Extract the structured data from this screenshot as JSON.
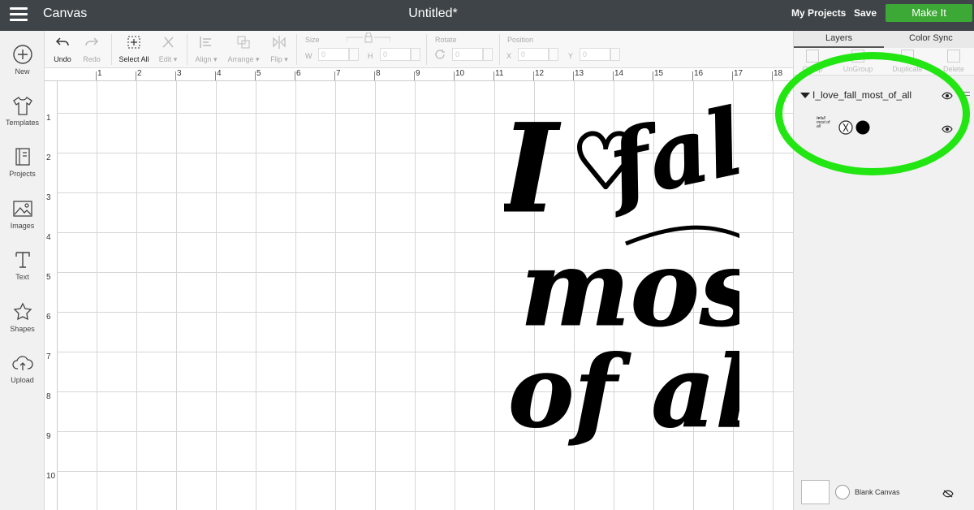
{
  "topbar": {
    "app_title": "Canvas",
    "doc_title": "Untitled*",
    "my_projects": "My Projects",
    "save": "Save",
    "make_it": "Make It",
    "make_it_color": "#3ca835"
  },
  "sidebar": {
    "items": [
      {
        "label": "New",
        "icon": "plus-circle-icon"
      },
      {
        "label": "Templates",
        "icon": "tshirt-icon"
      },
      {
        "label": "Projects",
        "icon": "book-icon"
      },
      {
        "label": "Images",
        "icon": "image-icon"
      },
      {
        "label": "Text",
        "icon": "text-t-icon"
      },
      {
        "label": "Shapes",
        "icon": "shapes-icon"
      },
      {
        "label": "Upload",
        "icon": "cloud-upload-icon"
      }
    ]
  },
  "toolbar": {
    "undo": "Undo",
    "redo": "Redo",
    "select_all": "Select All",
    "edit": "Edit ▾",
    "align": "Align ▾",
    "arrange": "Arrange ▾",
    "flip": "Flip ▾",
    "size_label": "Size",
    "w_label": "W",
    "h_label": "H",
    "w_value": "0",
    "h_value": "0",
    "rotate_label": "Rotate",
    "rotate_value": "0",
    "position_label": "Position",
    "x_label": "X",
    "y_label": "Y",
    "x_value": "0",
    "y_value": "0"
  },
  "rulers": {
    "horizontal": [
      "1",
      "2",
      "3",
      "4",
      "5",
      "6",
      "7",
      "8",
      "9",
      "10",
      "11",
      "12",
      "13",
      "14",
      "15",
      "16",
      "17",
      "18"
    ],
    "vertical": [
      "1",
      "2",
      "3",
      "4",
      "5",
      "6",
      "7",
      "8",
      "9",
      "10"
    ]
  },
  "design": {
    "lines": [
      "I",
      "fall",
      "most",
      "of all"
    ],
    "heart": "♥"
  },
  "layers_panel": {
    "tabs": [
      "Layers",
      "Color Sync"
    ],
    "actions": [
      "Group",
      "UnGroup",
      "Duplicate",
      "Delete"
    ],
    "layer_name": "I_love_fall_most_of_all",
    "thumb_text": "I♥fall most of all",
    "cut_color": "#000000",
    "blank_canvas": "Blank Canvas",
    "highlight_color": "#22e612"
  }
}
